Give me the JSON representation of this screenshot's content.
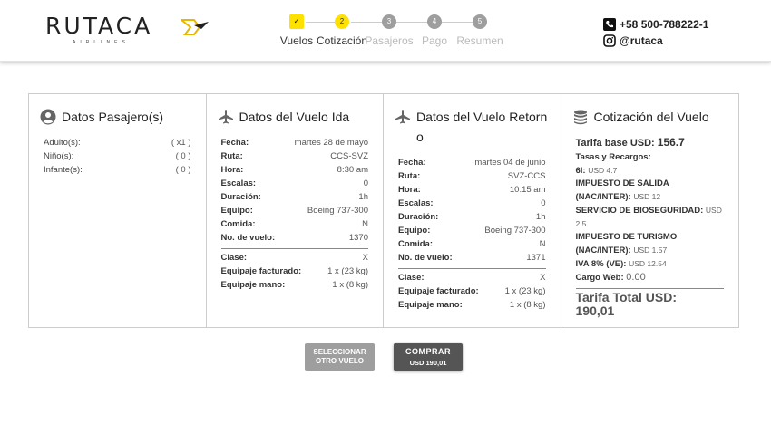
{
  "brand": {
    "name": "RUTACA",
    "tagline": "AIRLINES"
  },
  "steps": [
    {
      "num": "✓",
      "label": "Vuelos",
      "state": "done"
    },
    {
      "num": "2",
      "label": "Cotización",
      "state": "active"
    },
    {
      "num": "3",
      "label": "Pasajeros",
      "state": "todo"
    },
    {
      "num": "4",
      "label": "Pago",
      "state": "todo"
    },
    {
      "num": "5",
      "label": "Resumen",
      "state": "todo"
    }
  ],
  "contact": {
    "phone": "+58 500-788222-1",
    "instagram": "@rutaca"
  },
  "passengers": {
    "title": "Datos Pasajero(s)",
    "rows": [
      {
        "k": "Adulto(s):",
        "v": "( x1 )"
      },
      {
        "k": "Niño(s):",
        "v": "( 0 )"
      },
      {
        "k": "Infante(s):",
        "v": "( 0 )"
      }
    ]
  },
  "ida": {
    "title": "Datos del Vuelo Ida",
    "rows": [
      {
        "k": "Fecha:",
        "v": "martes 28 de mayo"
      },
      {
        "k": "Ruta:",
        "v": "CCS-SVZ"
      },
      {
        "k": "Hora:",
        "v": "8:30 am"
      },
      {
        "k": "Escalas:",
        "v": "0"
      },
      {
        "k": "Duración:",
        "v": "1h"
      },
      {
        "k": "Equipo:",
        "v": "Boeing 737-300"
      },
      {
        "k": "Comida:",
        "v": "N"
      },
      {
        "k": "No. de vuelo:",
        "v": "1370"
      }
    ],
    "extra": [
      {
        "k": "Clase:",
        "v": "X"
      },
      {
        "k": "Equipaje facturado:",
        "v": "1 x (23 kg)"
      },
      {
        "k": "Equipaje mano:",
        "v": "1 x (8 kg)"
      }
    ]
  },
  "retorno": {
    "title": "Datos del Vuelo Retorno",
    "rows": [
      {
        "k": "Fecha:",
        "v": "martes 04 de junio"
      },
      {
        "k": "Ruta:",
        "v": "SVZ-CCS"
      },
      {
        "k": "Hora:",
        "v": "10:15 am"
      },
      {
        "k": "Escalas:",
        "v": "0"
      },
      {
        "k": "Duración:",
        "v": "1h"
      },
      {
        "k": "Equipo:",
        "v": "Boeing 737-300"
      },
      {
        "k": "Comida:",
        "v": "N"
      },
      {
        "k": "No. de vuelo:",
        "v": "1371"
      }
    ],
    "extra": [
      {
        "k": "Clase:",
        "v": "X"
      },
      {
        "k": "Equipaje facturado:",
        "v": "1 x (23 kg)"
      },
      {
        "k": "Equipaje mano:",
        "v": "1 x (8 kg)"
      }
    ]
  },
  "cotizacion": {
    "title": "Cotización del Vuelo",
    "base_label": "Tarifa base USD:",
    "base_value": "156.7",
    "taxes_label": "Tasas y Recargos:",
    "items": [
      {
        "k": "6I:",
        "v": "USD 4.7"
      },
      {
        "k": "IMPUESTO DE SALIDA (NAC/INTER):",
        "v": "USD 12"
      },
      {
        "k": "SERVICIO DE BIOSEGURIDAD:",
        "v": "USD 2.5"
      },
      {
        "k": "IMPUESTO DE TURISMO (NAC/INTER):",
        "v": "USD 1.57"
      },
      {
        "k": "IVA 8% (VE):",
        "v": "USD 12.54"
      }
    ],
    "cargo_label": "Cargo Web:",
    "cargo_value": "0.00",
    "total_label": "Tarifa Total USD:",
    "total_value": "190,01"
  },
  "buttons": {
    "select_line1": "SELECCIONAR",
    "select_line2": "OTRO VUELO",
    "buy_main": "COMPRAR",
    "buy_sub": "USD 190,01"
  }
}
